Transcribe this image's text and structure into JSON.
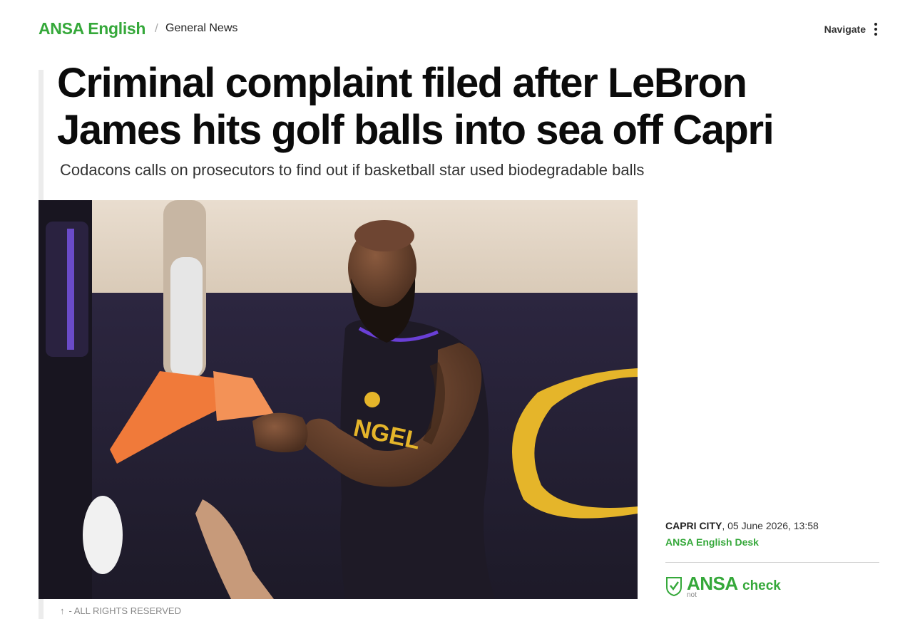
{
  "header": {
    "brand": "ANSA English",
    "separator": "/",
    "section": "General News",
    "nav_label": "Navigate"
  },
  "article": {
    "headline": "Criminal complaint filed after LeBron James hits golf balls into sea off Capri",
    "subheadline": "Codacons calls on prosecutors to find out if basketball star used biodegradable balls",
    "photo_caption": "- ALL RIGHTS RESERVED",
    "dateline_city": "CAPRI CITY",
    "dateline_rest": ", 05 June 2026, 13:58",
    "author": "ANSA English Desk"
  },
  "badge": {
    "logo_text": "ANSA",
    "word": "check",
    "sub": "not"
  },
  "colors": {
    "brand_green": "#35a83a",
    "headline": "#0b0b0b"
  },
  "icons": {
    "nav": "kebab-vertical-icon",
    "caption": "arrow-up-icon",
    "badge": "shield-check-icon"
  }
}
